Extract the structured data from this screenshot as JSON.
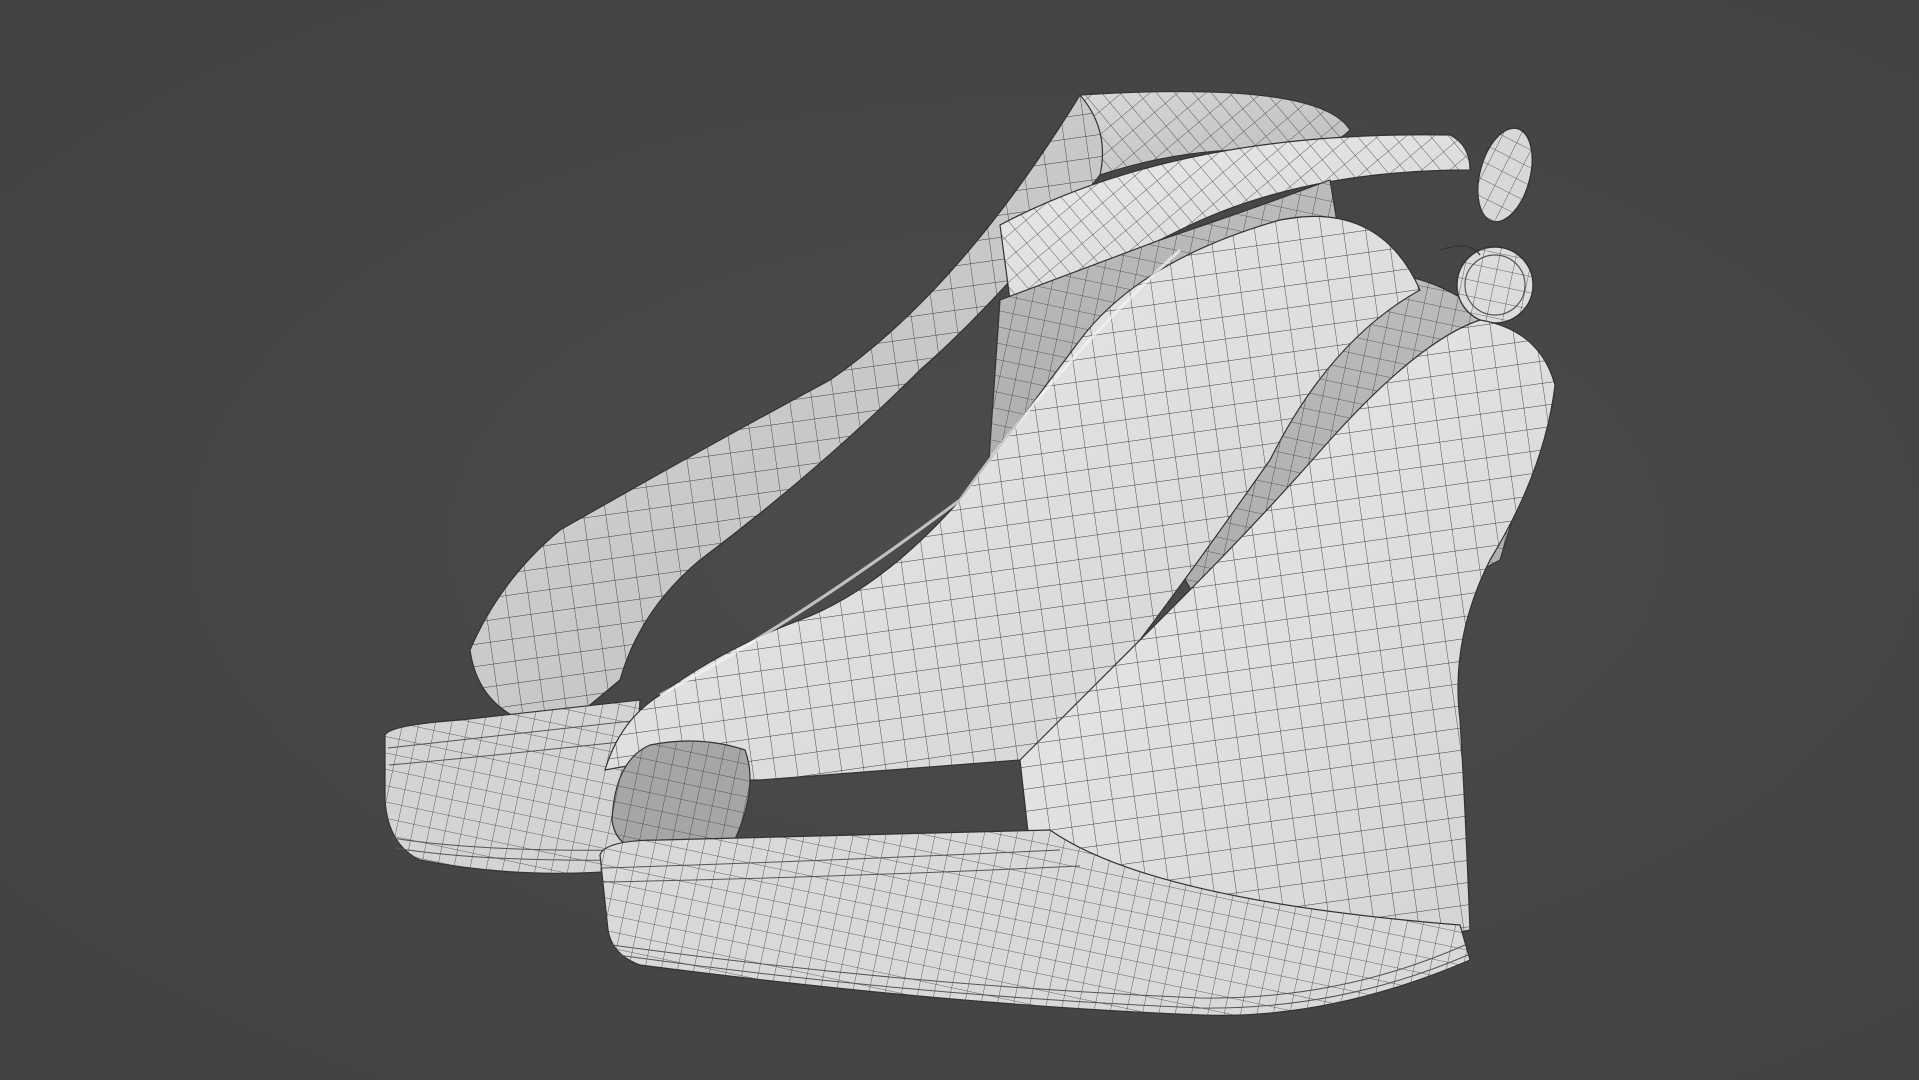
{
  "scene": {
    "subject": "wireframe-render-wedge-sandals",
    "background_color": "#464646",
    "model_color": "#e4e4e4",
    "wire_color": "#3a3a3a"
  }
}
